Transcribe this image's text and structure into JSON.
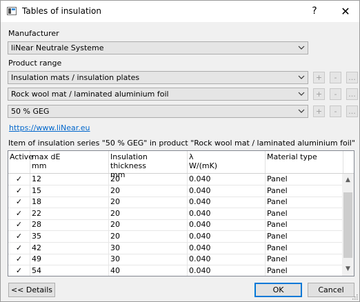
{
  "window": {
    "title": "Tables of insulation",
    "help_label": "?",
    "close_label": "✕",
    "app_icon": "table-app-icon"
  },
  "manufacturer": {
    "label": "Manufacturer",
    "value": "liNear Neutrale Systeme"
  },
  "product_range": {
    "label": "Product range",
    "combos": [
      {
        "value": "Insulation mats / insulation plates"
      },
      {
        "value": "Rock wool mat / laminated aluminium foil"
      },
      {
        "value": "50 % GEG"
      }
    ],
    "add_label": "+",
    "remove_label": "-",
    "more_label": "..."
  },
  "website_link": "https://www.liNear.eu",
  "table_caption": "Item of insulation series \"50 % GEG\" in product \"Rock wool mat / laminated aluminium foil\"",
  "table": {
    "columns": [
      {
        "label": "Active"
      },
      {
        "label": "max dE\nmm"
      },
      {
        "label": "Insulation thickness\nmm"
      },
      {
        "label": "λ\nW/(mK)"
      },
      {
        "label": "Material type"
      }
    ],
    "rows": [
      {
        "active": "✓",
        "max_de": "12",
        "thickness": "20",
        "lambda": "0.040",
        "material": "Panel"
      },
      {
        "active": "✓",
        "max_de": "15",
        "thickness": "20",
        "lambda": "0.040",
        "material": "Panel"
      },
      {
        "active": "✓",
        "max_de": "18",
        "thickness": "20",
        "lambda": "0.040",
        "material": "Panel"
      },
      {
        "active": "✓",
        "max_de": "22",
        "thickness": "20",
        "lambda": "0.040",
        "material": "Panel"
      },
      {
        "active": "✓",
        "max_de": "28",
        "thickness": "20",
        "lambda": "0.040",
        "material": "Panel"
      },
      {
        "active": "✓",
        "max_de": "35",
        "thickness": "20",
        "lambda": "0.040",
        "material": "Panel"
      },
      {
        "active": "✓",
        "max_de": "42",
        "thickness": "30",
        "lambda": "0.040",
        "material": "Panel"
      },
      {
        "active": "✓",
        "max_de": "49",
        "thickness": "30",
        "lambda": "0.040",
        "material": "Panel"
      },
      {
        "active": "✓",
        "max_de": "54",
        "thickness": "40",
        "lambda": "0.040",
        "material": "Panel"
      }
    ]
  },
  "buttons": {
    "details": "<< Details",
    "ok": "OK",
    "cancel": "Cancel"
  },
  "colors": {
    "accent": "#0078d7",
    "link": "#0066cc",
    "title_bar": "#ffffff",
    "dialog_bg": "#f0f0f0"
  }
}
